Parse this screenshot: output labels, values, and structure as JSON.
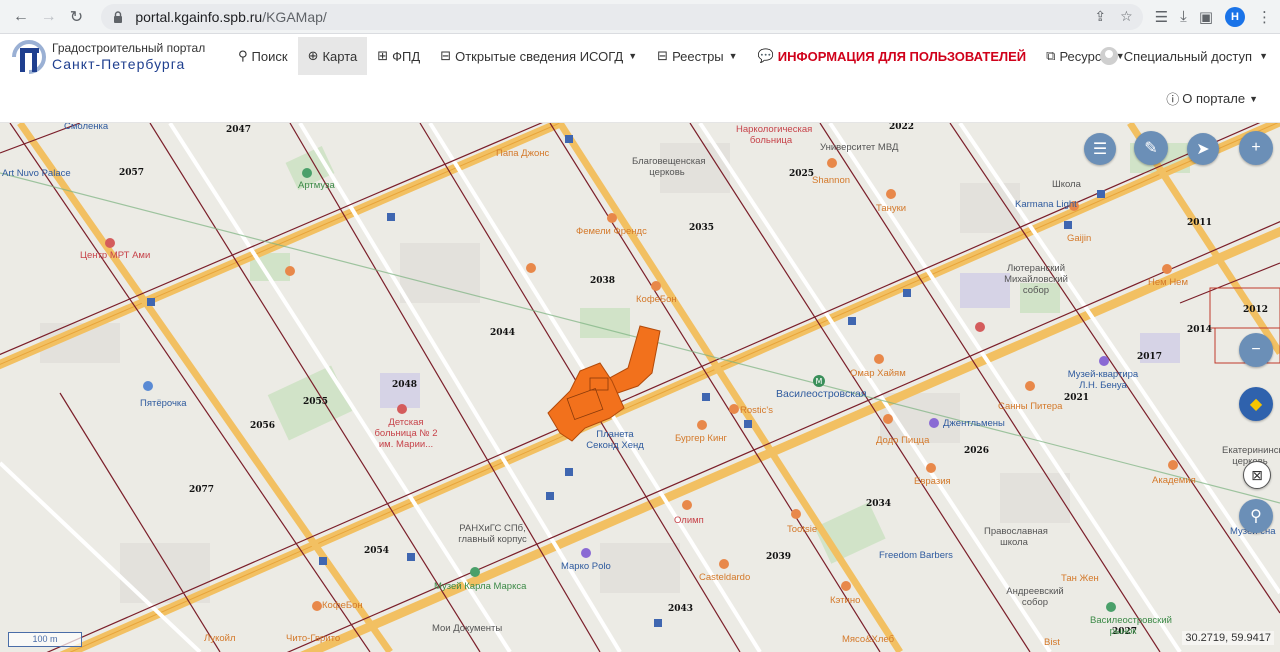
{
  "browser": {
    "host": "portal.kgainfo.spb.ru",
    "path": "/KGAMap/",
    "profile_initial": "Н"
  },
  "header": {
    "logo_line1": "Градостроительный портал",
    "logo_line2": "Санкт-Петербурга",
    "menu": [
      {
        "label": "Поиск",
        "icon": "search-icon"
      },
      {
        "label": "Карта",
        "icon": "globe-icon",
        "active": true
      },
      {
        "label": "ФПД",
        "icon": "map-icon"
      },
      {
        "label": "Открытые сведения ИСОГД",
        "icon": "table-icon",
        "dropdown": true
      },
      {
        "label": "Реестры",
        "icon": "table-icon",
        "dropdown": true
      },
      {
        "label": "ИНФОРМАЦИЯ ДЛЯ ПОЛЬЗОВАТЕЛЕЙ",
        "icon": "comments-icon",
        "highlight": true
      },
      {
        "label": "Ресурсы",
        "icon": "external-link-icon",
        "dropdown": true
      }
    ],
    "special_access": "Специальный доступ",
    "about": "О портале"
  },
  "map": {
    "scale_label": "100 m",
    "coordinates": "30.2719, 59.9417",
    "quarter_numbers": [
      "2047",
      "2057",
      "2022",
      "2025",
      "2035",
      "2038",
      "2044",
      "2048",
      "2055",
      "2056",
      "2077",
      "2054",
      "2043",
      "2039",
      "2034",
      "2026",
      "2021",
      "2017",
      "2014",
      "2012",
      "2011",
      "2027"
    ],
    "poi_labels": [
      "Смоленка",
      "Art Nuvo Palace",
      "Артмуза",
      "Папа Джонс",
      "Благовещенская церковь",
      "Наркологическая больница",
      "Университет МВД",
      "Shannon",
      "Тануки",
      "Школа",
      "Karmana Light",
      "Gaijin",
      "Лютеранский Михайловский собор",
      "Нем Нем",
      "Центр МРТ Ами",
      "Фемели Френдс",
      "КофеБон",
      "Пятёрочка",
      "Детская больница № 2 им. Марии...",
      "Планета Секонд Хенд",
      "Бургер Кинг",
      "Rostic's",
      "Василеостровская",
      "Омар Хайям",
      "Джентльмены",
      "Музей-квартира Л.Н. Бенуа",
      "Санны Питера",
      "Додо Пицца",
      "Евразия",
      "Академия",
      "Tootsie",
      "Freedom Barbers",
      "Православная школа",
      "Тан Жен",
      "Андреевский собор",
      "Марко Polo",
      "Музей Карла Маркса",
      "Casteldardo",
      "Кэтино",
      "Мои Документы",
      "Чито-Гврито",
      "Лукойл",
      "КофеБон",
      "Мясо&Хлеб",
      "Bist",
      "Василеостровский рынок",
      "РАНХиГС СПб, главный корпус",
      "Олимп",
      "Екатерининская церковь",
      "Музей сна"
    ]
  }
}
